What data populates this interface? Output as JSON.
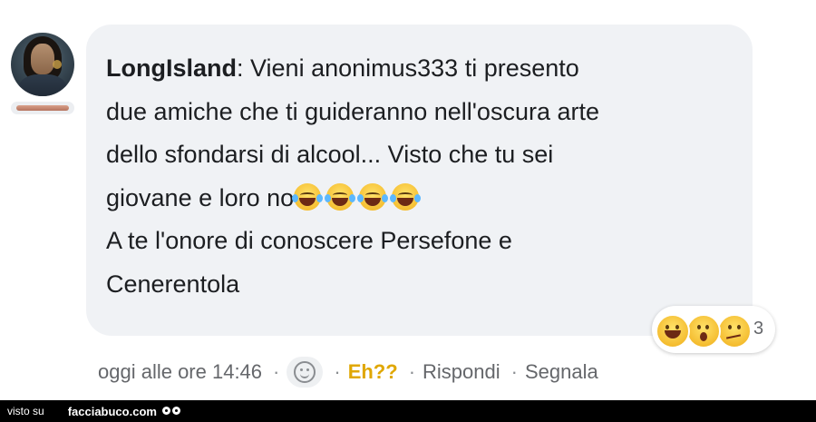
{
  "comment": {
    "author": "LongIsland",
    "separator": ":",
    "lines": [
      " Vieni anonimus333 ti presento",
      "due amiche che ti guideranno nell'oscura arte",
      "dello sfondarsi di alcool... Visto che tu sei",
      "giovane e loro no",
      "A te l'onore di conoscere Persefone e",
      "Cenerentola"
    ],
    "inline_emojis": [
      "face-with-tears-of-joy",
      "face-with-tears-of-joy",
      "face-with-tears-of-joy",
      "face-with-tears-of-joy"
    ]
  },
  "reactions": {
    "icons": [
      "laughing-icon",
      "wow-icon",
      "thinking-icon"
    ],
    "count": "3"
  },
  "actions": {
    "timestamp": "oggi alle ore 14:46",
    "dot": "·",
    "react_icon": "smiley-outline-icon",
    "selected_reaction": "Eh??",
    "reply": "Rispondi",
    "report": "Segnala"
  },
  "footer": {
    "visto_su": "visto su",
    "site": "facciabuco.com"
  },
  "colors": {
    "bubble": "#f0f2f5",
    "text": "#1c1e21",
    "muted": "#65676b",
    "accent_reaction": "#e0a700",
    "footer_bg": "#000000"
  }
}
